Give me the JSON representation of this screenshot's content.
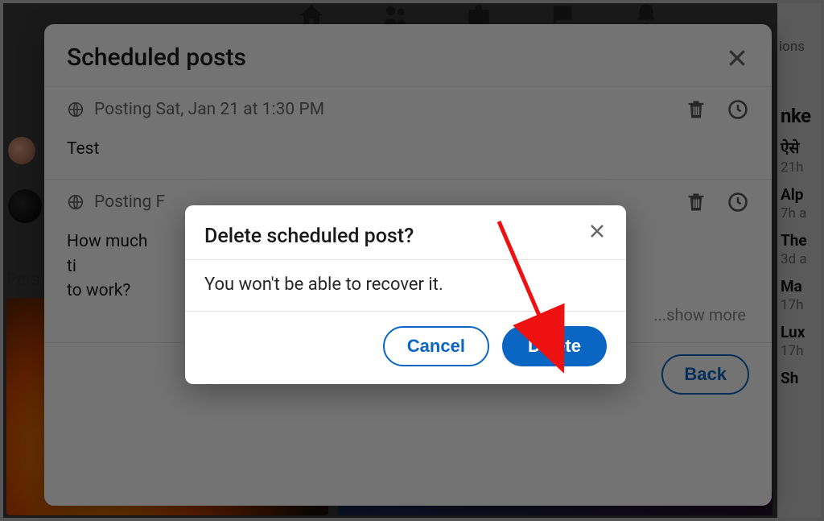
{
  "right": {
    "heading": "nke",
    "ions": "ions",
    "items": [
      {
        "head": "ऐसे",
        "time": "21h"
      },
      {
        "head": "Alp",
        "time": "7h a"
      },
      {
        "head": "The",
        "time": "3d a"
      },
      {
        "head": "Ma",
        "time": "17h"
      },
      {
        "head": "Lux",
        "time": "17h"
      },
      {
        "head": "Sh",
        "time": ""
      }
    ]
  },
  "left": {
    "pers": "Pers"
  },
  "panel": {
    "title": "Scheduled posts",
    "posts": [
      {
        "meta": "Posting Sat, Jan 21 at 1:30 PM",
        "body": "Test"
      },
      {
        "meta": "Posting F",
        "body": "How much ti                                                                                                                                                                                                                                                                                                                                                                                                                                                                                                                                                                                                                                                                                                                                                                                                                                                                                                                                                                mmuting to work?",
        "show_more": "...show more"
      }
    ],
    "back": "Back"
  },
  "dialog": {
    "title": "Delete scheduled post?",
    "body": "You won't be able to recover it.",
    "cancel": "Cancel",
    "delete": "Delete"
  }
}
